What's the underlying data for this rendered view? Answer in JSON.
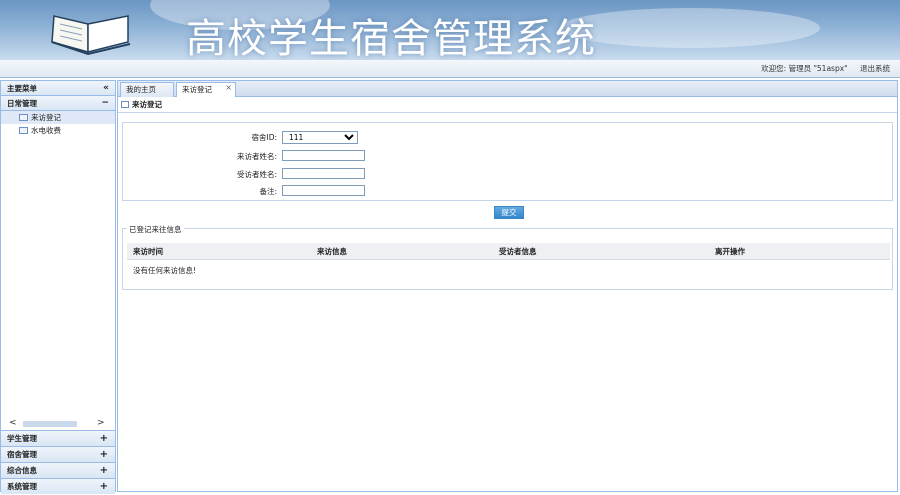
{
  "header": {
    "title": "高校学生宿舍管理系统"
  },
  "infobar": {
    "welcome": "欢迎您: 管理员 \"51aspx\"",
    "logout": "退出系统"
  },
  "sidebar": {
    "title": "主要菜单",
    "collapse_icon": "double-chevron-left",
    "group": {
      "label": "日常管理",
      "toggle": "−"
    },
    "items": [
      {
        "label": "来访登记",
        "icon": "table-icon",
        "active": true
      },
      {
        "label": "水电收费",
        "icon": "table-icon",
        "active": false
      }
    ],
    "accordion": [
      {
        "label": "学生管理",
        "toggle": "+"
      },
      {
        "label": "宿舍管理",
        "toggle": "+"
      },
      {
        "label": "综合信息",
        "toggle": "+"
      },
      {
        "label": "系统管理",
        "toggle": "+"
      }
    ],
    "scroll_left": "<",
    "scroll_right": ">"
  },
  "tabs": [
    {
      "label": "我的主页",
      "active": false
    },
    {
      "label": "来访登记",
      "active": true,
      "close": "×"
    }
  ],
  "panel": {
    "title": "来访登记"
  },
  "form": {
    "dorm_id_label": "宿舍ID:",
    "dorm_id_value": "111",
    "visitor_label": "来访者姓名:",
    "visitor_value": "",
    "visitee_label": "受访者姓名:",
    "visitee_value": "",
    "note_label": "备注:",
    "note_value": "",
    "submit_label": "提交"
  },
  "records": {
    "legend": "已登记来往信息",
    "columns": [
      "来访时间",
      "来访信息",
      "受访者信息",
      "离开操作"
    ],
    "empty_message": "没有任何来访信息!"
  }
}
